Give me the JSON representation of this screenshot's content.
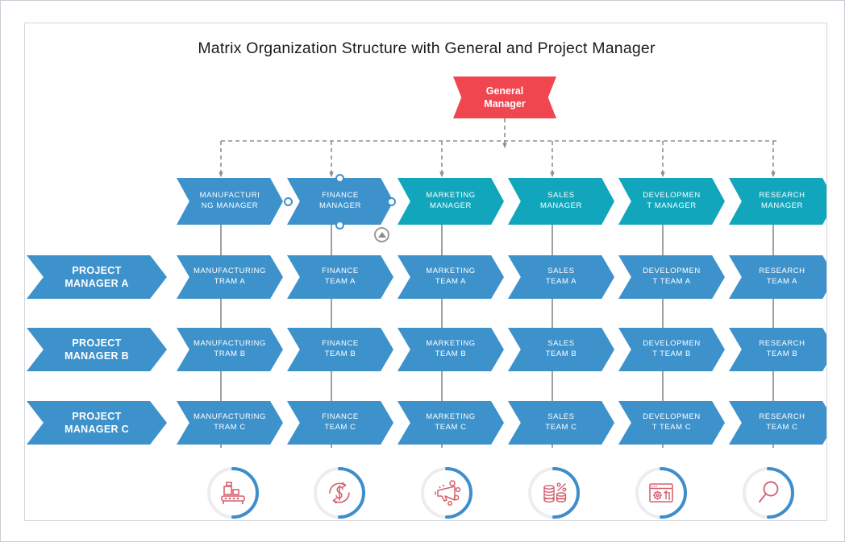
{
  "chart_data": {
    "type": "diagram",
    "title": "Matrix Organization Structure with General and Project Manager",
    "diagram_kind": "matrix-org-chart",
    "colors": {
      "red": "#ef4650",
      "blue": "#3e92cc",
      "teal": "#12a6bd",
      "connector": "#8f8f8f",
      "icon_red": "#d4626f",
      "ring_blue": "#3e8ecc",
      "ring_track": "#ededf0"
    },
    "root": {
      "label": "General\nManager",
      "line1": "General",
      "line2": "Manager",
      "color": "#ef4650"
    },
    "column_headers": [
      {
        "line1": "MANUFACTURI",
        "line2": "NG MANAGER",
        "color": "#3e92cc",
        "selected": false
      },
      {
        "line1": "FINANCE",
        "line2": "MANAGER",
        "color": "#3e92cc",
        "selected": true
      },
      {
        "line1": "MARKETING",
        "line2": "MANAGER",
        "color": "#12a6bd",
        "selected": false
      },
      {
        "line1": "SALES",
        "line2": "MANAGER",
        "color": "#12a6bd",
        "selected": false
      },
      {
        "line1": "DEVELOPMEN",
        "line2": "T MANAGER",
        "color": "#12a6bd",
        "selected": false
      },
      {
        "line1": "RESEARCH",
        "line2": "MANAGER",
        "color": "#12a6bd",
        "selected": false
      }
    ],
    "row_headers": [
      {
        "line1": "PROJECT",
        "line2": "MANAGER A",
        "color": "#3e92cc"
      },
      {
        "line1": "PROJECT",
        "line2": "MANAGER B",
        "color": "#3e92cc"
      },
      {
        "line1": "PROJECT",
        "line2": "MANAGER C",
        "color": "#3e92cc"
      }
    ],
    "cells": [
      [
        {
          "line1": "MANUFACTURING",
          "line2": "TRAM A"
        },
        {
          "line1": "FINANCE",
          "line2": "TEAM A"
        },
        {
          "line1": "MARKETING",
          "line2": "TEAM A"
        },
        {
          "line1": "SALES",
          "line2": "TEAM A"
        },
        {
          "line1": "DEVELOPMEN",
          "line2": "T TEAM A"
        },
        {
          "line1": "RESEARCH",
          "line2": "TEAM A"
        }
      ],
      [
        {
          "line1": "MANUFACTURING",
          "line2": "TRAM B"
        },
        {
          "line1": "FINANCE",
          "line2": "TEAM B"
        },
        {
          "line1": "MARKETING",
          "line2": "TEAM B"
        },
        {
          "line1": "SALES",
          "line2": "TEAM B"
        },
        {
          "line1": "DEVELOPMEN",
          "line2": "T TEAM B"
        },
        {
          "line1": "RESEARCH",
          "line2": "TEAM B"
        }
      ],
      [
        {
          "line1": "MANUFACTURING",
          "line2": "TRAM C"
        },
        {
          "line1": "FINANCE",
          "line2": "TEAM C"
        },
        {
          "line1": "MARKETING",
          "line2": "TEAM C"
        },
        {
          "line1": "SALES",
          "line2": "TEAM C"
        },
        {
          "line1": "DEVELOPMEN",
          "line2": "T TEAM C"
        },
        {
          "line1": "RESEARCH",
          "line2": "TEAM C"
        }
      ]
    ],
    "footer_icons": [
      {
        "name": "conveyor-belt-icon",
        "meaning": "manufacturing"
      },
      {
        "name": "dollar-cycle-icon",
        "meaning": "finance"
      },
      {
        "name": "megaphone-icon",
        "meaning": "marketing"
      },
      {
        "name": "coin-stack-percent-icon",
        "meaning": "sales"
      },
      {
        "name": "browser-gear-icon",
        "meaning": "development"
      },
      {
        "name": "magnifier-icon",
        "meaning": "research"
      }
    ],
    "selection": {
      "selected_node": "FINANCE MANAGER",
      "handles": 4,
      "action_button": "collapse-expand-triangle"
    }
  }
}
